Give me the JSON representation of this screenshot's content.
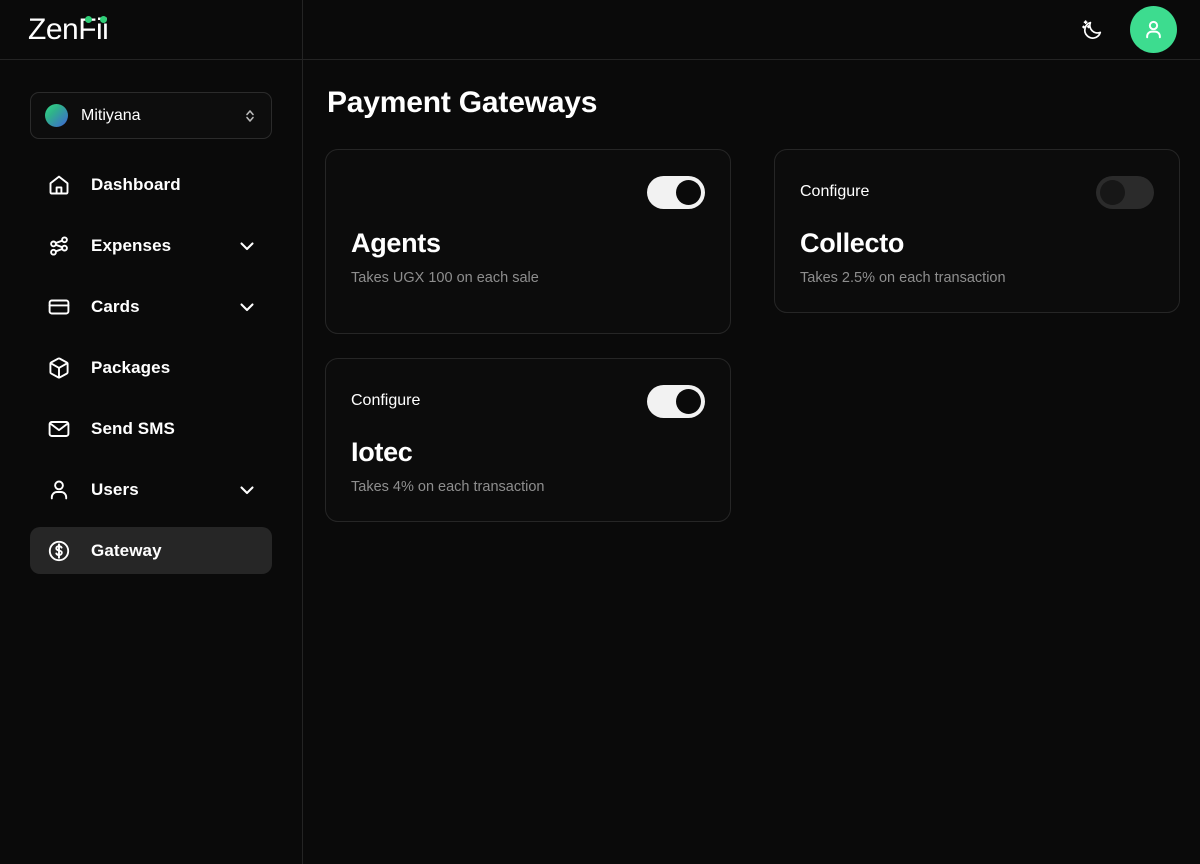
{
  "brand": {
    "text": "ZenFii",
    "dot_color": "#2fcf78"
  },
  "sidebar": {
    "org_selector": {
      "name": "Mitiyana",
      "icon": "org-avatar-gradient",
      "chevron_icon": "chevron-up-down-icon"
    },
    "items": [
      {
        "label": "Dashboard",
        "icon": "home-icon",
        "expandable": false,
        "active": false
      },
      {
        "label": "Expenses",
        "icon": "network-share-icon",
        "expandable": true,
        "active": false
      },
      {
        "label": "Cards",
        "icon": "credit-card-icon",
        "expandable": true,
        "active": false
      },
      {
        "label": "Packages",
        "icon": "package-box-icon",
        "expandable": false,
        "active": false
      },
      {
        "label": "Send SMS",
        "icon": "envelope-icon",
        "expandable": false,
        "active": false
      },
      {
        "label": "Users",
        "icon": "user-icon",
        "expandable": true,
        "active": false
      },
      {
        "label": "Gateway",
        "icon": "dollar-circle-icon",
        "expandable": false,
        "active": true
      }
    ]
  },
  "topbar": {
    "theme_toggle_icon": "moon-stars-icon",
    "avatar_icon": "user-avatar-icon",
    "avatar_color": "#3ddc8f"
  },
  "main": {
    "title": "Payment Gateways",
    "gateways": [
      {
        "name": "Agents",
        "description": "Takes UGX 100 on each sale",
        "configure_label": "",
        "has_configure": false,
        "enabled": true,
        "toggle_state": "on"
      },
      {
        "name": "Collecto",
        "description": "Takes 2.5% on each transaction",
        "configure_label": "Configure",
        "has_configure": true,
        "enabled": false,
        "toggle_state": "off"
      },
      {
        "name": "Iotec",
        "description": "Takes 4% on each transaction",
        "configure_label": "Configure",
        "has_configure": true,
        "enabled": true,
        "toggle_state": "on"
      }
    ]
  }
}
